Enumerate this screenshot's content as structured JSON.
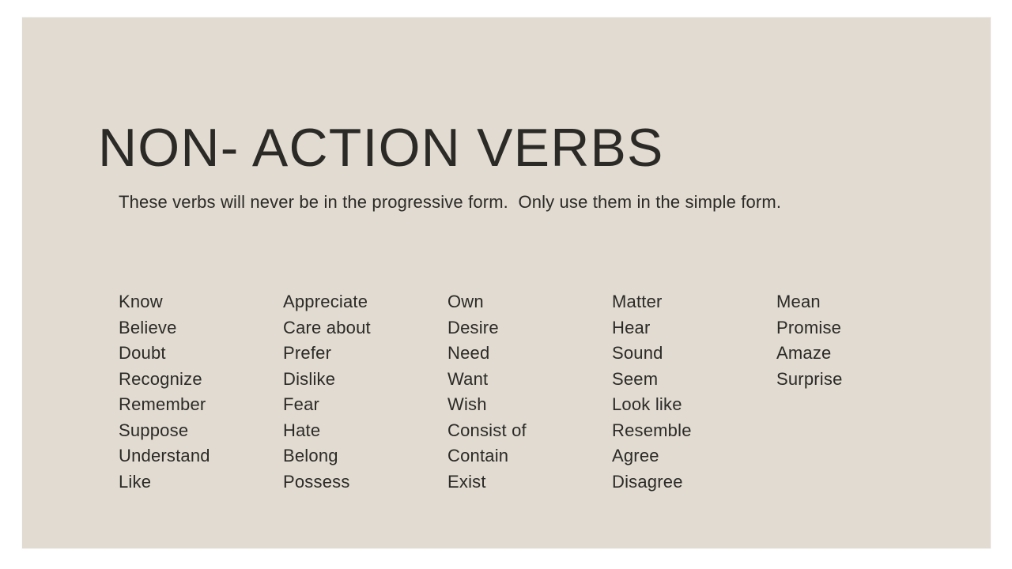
{
  "slide": {
    "title": "NON- ACTION VERBS",
    "subtitle": "These verbs will never be in the progressive form.  Only use them in the simple form.",
    "background_color": "#e1dbd1",
    "text_color": "#2b2a26",
    "page_color": "#ffffff",
    "verb_columns": [
      {
        "id": "column-1",
        "items": [
          "Know",
          "Believe",
          "Doubt",
          "Recognize",
          "Remember",
          "Suppose",
          "Understand",
          "Like"
        ]
      },
      {
        "id": "column-2",
        "items": [
          "Appreciate",
          "Care about",
          "Prefer",
          "Dislike",
          "Fear",
          "Hate",
          "Belong",
          "Possess"
        ]
      },
      {
        "id": "column-3",
        "items": [
          "Own",
          "Desire",
          "Need",
          "Want",
          "Wish",
          "Consist of",
          "Contain",
          "Exist"
        ]
      },
      {
        "id": "column-4",
        "items": [
          "Matter",
          "Hear",
          "Sound",
          "Seem",
          "Look like",
          "Resemble",
          "Agree",
          "Disagree"
        ]
      },
      {
        "id": "column-5",
        "items": [
          "Mean",
          "Promise",
          "Amaze",
          "Surprise"
        ]
      }
    ]
  }
}
